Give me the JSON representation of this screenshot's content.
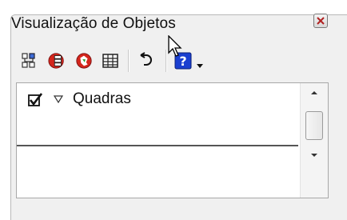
{
  "window": {
    "title": "Visualização de Objetos",
    "close_icon": "close-icon"
  },
  "toolbar": {
    "items": [
      {
        "icon": "layer-tree-icon"
      },
      {
        "icon": "red-layers-icon"
      },
      {
        "icon": "red-globe-icon"
      },
      {
        "icon": "table-grid-icon"
      },
      {
        "icon": "undo-arrow-icon"
      },
      {
        "icon": "help-icon"
      },
      {
        "icon": "dropdown-arrow-icon"
      }
    ]
  },
  "layers": {
    "items": [
      {
        "label": "Quadras",
        "checked": true,
        "expanded": true
      }
    ]
  },
  "colors": {
    "panel_bg": "#f0f0f0",
    "list_bg": "#ffffff",
    "help_blue": "#1a3fd0",
    "icon_red": "#d4261c"
  }
}
